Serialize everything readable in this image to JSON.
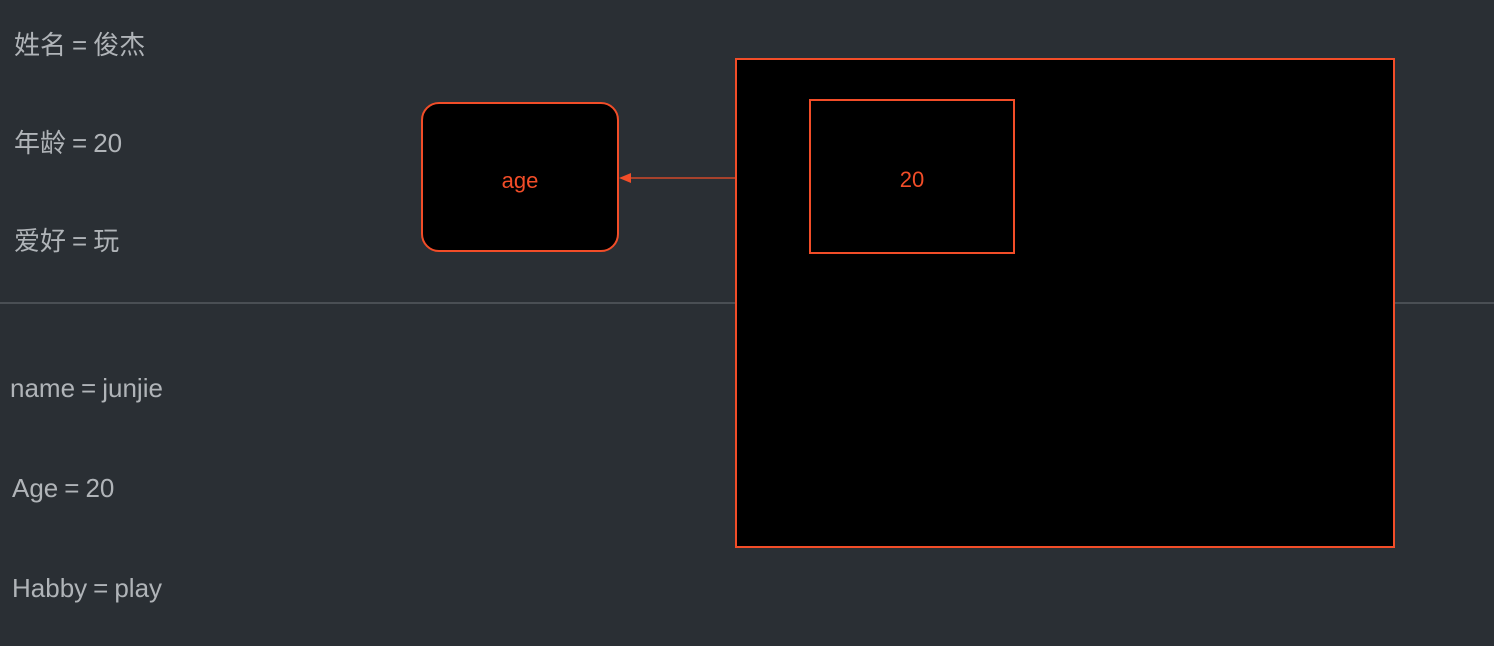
{
  "colors": {
    "bg": "#2a2f34",
    "text": "#b0b4b8",
    "accent": "#f24d28",
    "box_bg": "#000000"
  },
  "assignments_zh": [
    {
      "key": "姓名",
      "value": "俊杰"
    },
    {
      "key": "年龄",
      "value": "20"
    },
    {
      "key": "爱好",
      "value": "玩"
    }
  ],
  "assignments_en": [
    {
      "key": "name",
      "value": "junjie"
    },
    {
      "key": "Age",
      "value": "20"
    },
    {
      "key": "Habby",
      "value": "play"
    }
  ],
  "diagram": {
    "variable_label": "age",
    "value_label": "20"
  },
  "eq_symbol": "="
}
